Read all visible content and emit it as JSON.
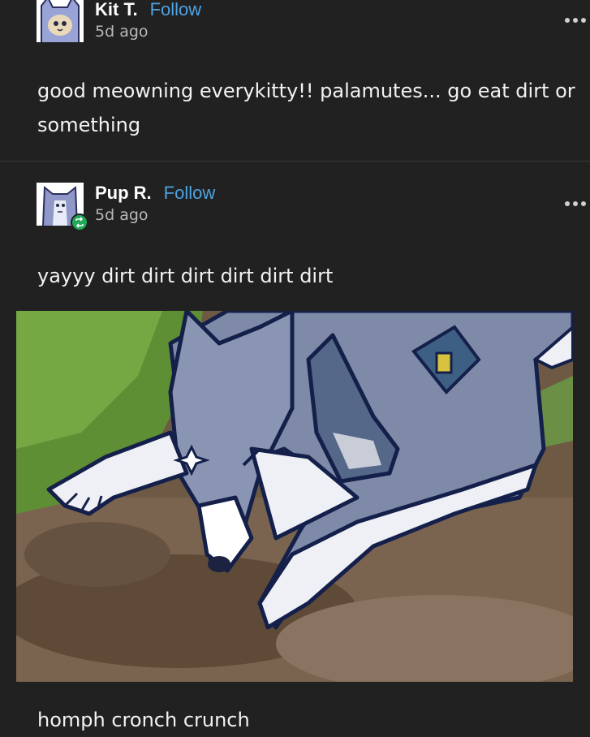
{
  "posts": [
    {
      "author": "Kit T.",
      "follow_label": "Follow",
      "time": "5d ago",
      "more_icon": "ellipsis-icon",
      "avatar_icon": "cat-avatar",
      "text": "good meowning everykitty!! palamutes... go eat dirt or something"
    },
    {
      "author": "Pup R.",
      "follow_label": "Follow",
      "time": "5d ago",
      "more_icon": "ellipsis-icon",
      "avatar_icon": "dog-avatar",
      "badge_icon": "reblog-icon",
      "text": "yayyy dirt dirt dirt dirt dirt dirt",
      "image_name": "dog-eating-dirt-drawing",
      "caption": "homph cronch crunch"
    }
  ],
  "colors": {
    "background": "#212121",
    "accent": "#4da3e3",
    "badge": "#1faa59"
  }
}
